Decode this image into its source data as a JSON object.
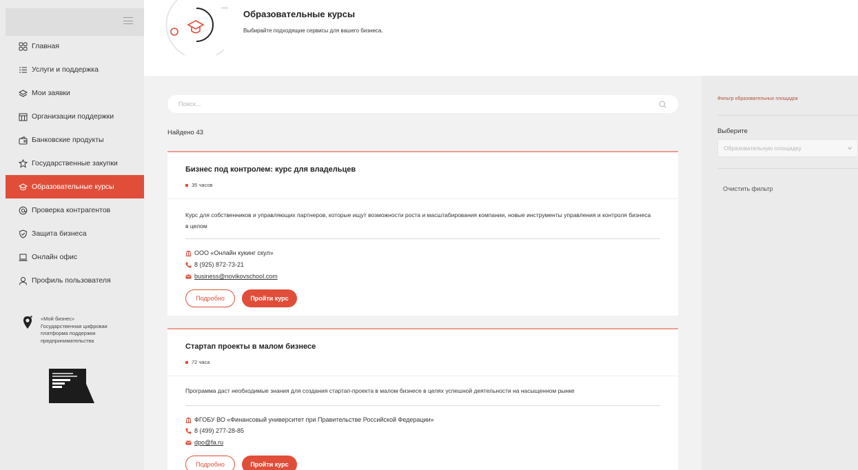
{
  "sidebar": {
    "items": [
      {
        "label": "Главная",
        "icon": "grid-icon"
      },
      {
        "label": "Услуги и поддержка",
        "icon": "list-icon"
      },
      {
        "label": "Мои заявки",
        "icon": "layers-icon"
      },
      {
        "label": "Организации поддержки",
        "icon": "building-icon"
      },
      {
        "label": "Банковские продукты",
        "icon": "wallet-icon"
      },
      {
        "label": "Государственные закупки",
        "icon": "emblem-icon"
      },
      {
        "label": "Образовательные курсы",
        "icon": "graduation-cap-icon",
        "active": true
      },
      {
        "label": "Проверка контрагентов",
        "icon": "at-icon"
      },
      {
        "label": "Защита бизнеса",
        "icon": "shield-icon"
      },
      {
        "label": "Онлайн офис",
        "icon": "laptop-icon"
      },
      {
        "label": "Профиль пользователя",
        "icon": "user-icon"
      }
    ],
    "brand": {
      "line1": "«Мой бизнес»",
      "line2": "Государственная цифровая",
      "line3": "платформа поддержки",
      "line4": "предпринимательства"
    },
    "np_logo_text": "МАЛОЕ И СРЕДНЕЕ ПРЕДПРИНИМАТЕЛЬСТВО НАЦИОНАЛЬНЫЕ ПРОЕКТЫ РОССИИ"
  },
  "header": {
    "title": "Образовательные курсы",
    "subtitle": "Выбирайте подходящие сервисы для вашего бизнеса."
  },
  "search": {
    "placeholder": "Поиск..."
  },
  "found_text": "Найдено 43",
  "courses": [
    {
      "title": "Бизнес под контролем: курс для владельцев",
      "hours": "35 часов",
      "description": "Курс для собственников и управляющих партнеров, которые ищут возможности роста и масштабирования компании, новые инструменты управления и контроля бизнеса в целом",
      "org": "ООО «Онлайн кукинг скул»",
      "phone": "8 (925) 872-73-21",
      "email": "business@novikovschool.com",
      "details_label": "Подробно",
      "enroll_label": "Пройти курс"
    },
    {
      "title": "Стартап проекты в малом бизнесе",
      "hours": "72 часа",
      "description": "Программа даст необходимые знания для создания стартап-проекта в малом бизнесе в целях успешной деятельности на насыщенном рынке",
      "org": "ФГОБУ ВО «Финансовый университет при Правительстве Российской Федерации»",
      "phone": "8 (499) 277-28-85",
      "email": "dpo@fa.ru",
      "details_label": "Подробно",
      "enroll_label": "Пройти курс"
    }
  ],
  "filter": {
    "title": "Фильтр образовательных площадок",
    "choose_label": "Выберите",
    "select_placeholder": "Образовательную площадку",
    "clear_label": "Очистить фильтр"
  },
  "colors": {
    "accent": "#e04e39",
    "sidebar_bg": "#ebebeb",
    "page_bg": "#f2f2f2"
  }
}
